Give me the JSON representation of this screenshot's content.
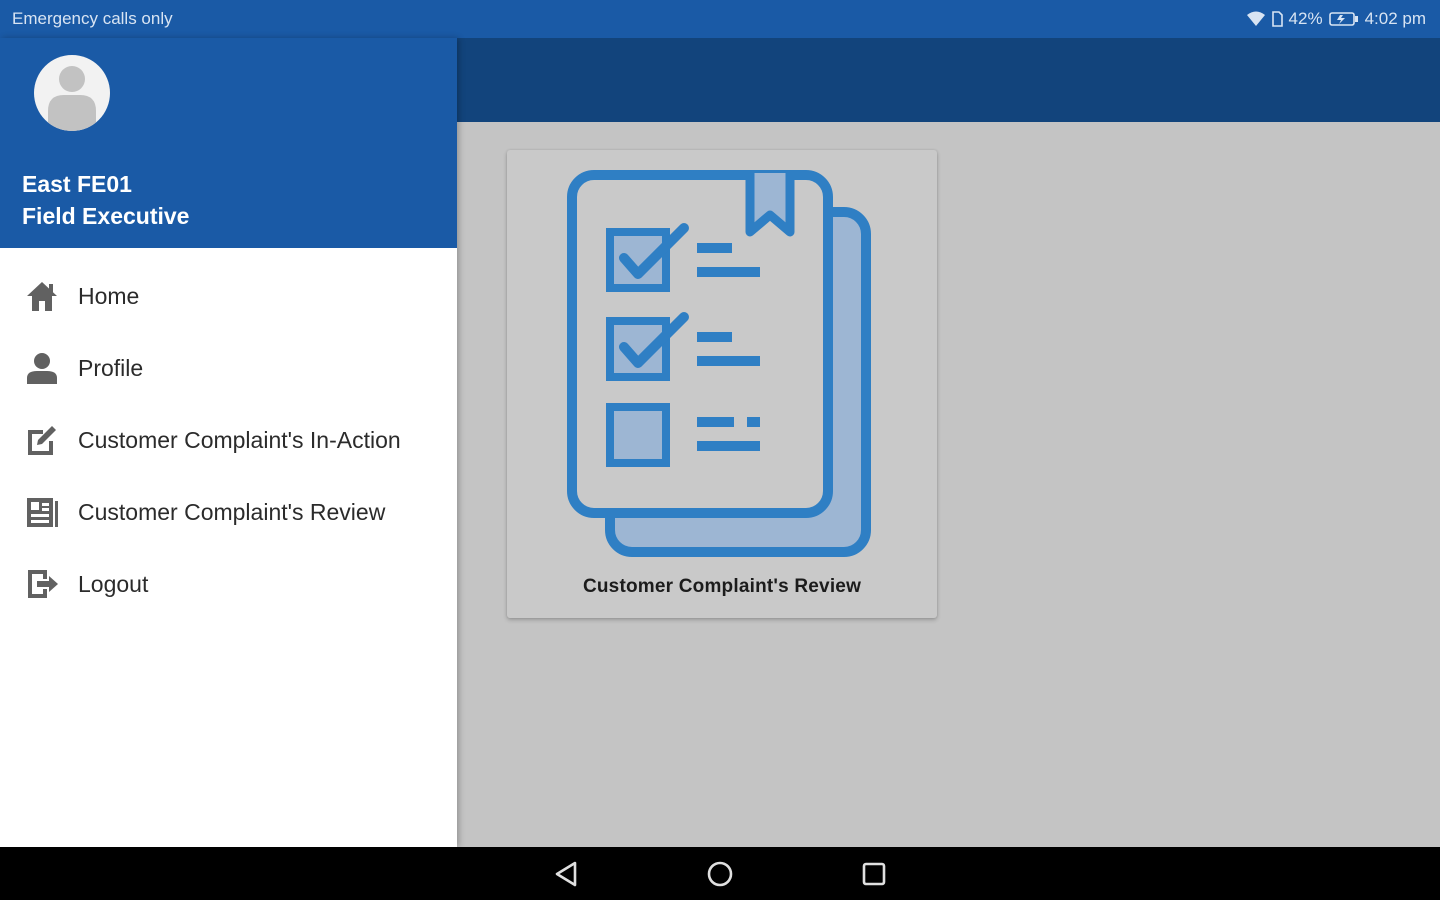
{
  "status_bar": {
    "carrier_text": "Emergency calls only",
    "battery_percent": "42%",
    "time": "4:02 pm",
    "icons": [
      "wifi-icon",
      "sim-icon",
      "battery-icon"
    ]
  },
  "drawer": {
    "user": {
      "name": "East FE01",
      "role": "Field Executive",
      "avatar_icon": "person-avatar-icon"
    },
    "menu": [
      {
        "label": "Home",
        "icon": "home-icon"
      },
      {
        "label": "Profile",
        "icon": "person-icon"
      },
      {
        "label": "Customer Complaint's In-Action",
        "icon": "edit-icon"
      },
      {
        "label": "Customer Complaint's Review",
        "icon": "review-list-icon"
      },
      {
        "label": "Logout",
        "icon": "logout-icon"
      }
    ]
  },
  "main": {
    "cards": [
      {
        "label": "Customer Complaint's Review",
        "icon": "checklist-document-icon"
      }
    ]
  },
  "colors": {
    "primary": "#1a5aa6",
    "app_bar": "#12447c",
    "icon_blue": "#2f7fc4",
    "icon_fill": "#9db6d3",
    "menu_icon": "#616161"
  },
  "nav_bar": {
    "buttons": [
      "back-icon",
      "home-circle-icon",
      "recents-icon"
    ]
  }
}
